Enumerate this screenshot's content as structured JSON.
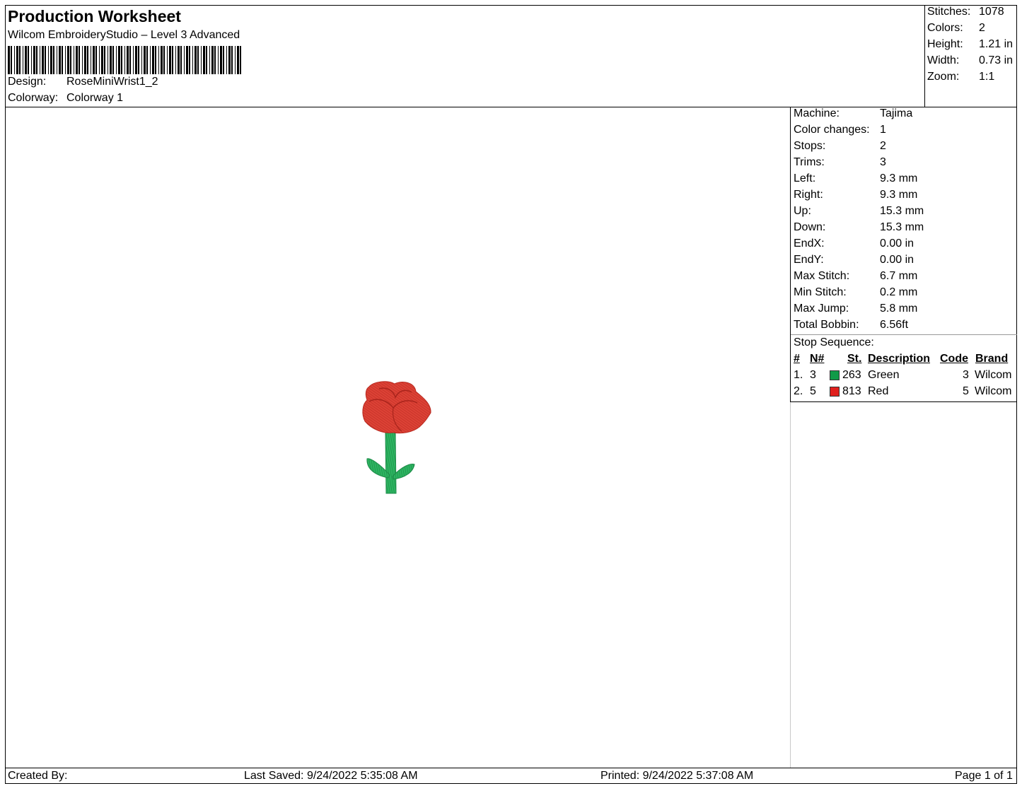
{
  "header": {
    "title": "Production Worksheet",
    "subtitle": "Wilcom EmbroideryStudio – Level 3 Advanced",
    "design_label": "Design:",
    "design_value": "RoseMiniWrist1_2",
    "colorway_label": "Colorway:",
    "colorway_value": "Colorway 1"
  },
  "summary": {
    "stitches_label": "Stitches:",
    "stitches_value": "1078",
    "colors_label": "Colors:",
    "colors_value": "2",
    "height_label": "Height:",
    "height_value": "1.21 in",
    "width_label": "Width:",
    "width_value": "0.73 in",
    "zoom_label": "Zoom:",
    "zoom_value": "1:1"
  },
  "stats": [
    {
      "label": "Machine:",
      "value": "Tajima"
    },
    {
      "label": "Color changes:",
      "value": "1"
    },
    {
      "label": "Stops:",
      "value": "2"
    },
    {
      "label": "Trims:",
      "value": "3"
    },
    {
      "label": "Left:",
      "value": "9.3 mm"
    },
    {
      "label": "Right:",
      "value": "9.3 mm"
    },
    {
      "label": "Up:",
      "value": "15.3 mm"
    },
    {
      "label": "Down:",
      "value": "15.3 mm"
    },
    {
      "label": "EndX:",
      "value": "0.00 in"
    },
    {
      "label": "EndY:",
      "value": "0.00 in"
    },
    {
      "label": "Max Stitch:",
      "value": "6.7 mm"
    },
    {
      "label": "Min Stitch:",
      "value": "0.2 mm"
    },
    {
      "label": "Max Jump:",
      "value": "5.8 mm"
    },
    {
      "label": "Total Bobbin:",
      "value": "6.56ft"
    }
  ],
  "stop_sequence": {
    "title": "Stop Sequence:",
    "headers": {
      "num": "#",
      "n": "N#",
      "st": "St.",
      "desc": "Description",
      "code": "Code",
      "brand": "Brand"
    },
    "rows": [
      {
        "num": "1.",
        "n": "3",
        "color": "#109a48",
        "st": "263",
        "desc": "Green",
        "code": "3",
        "brand": "Wilcom"
      },
      {
        "num": "2.",
        "n": "5",
        "color": "#e0201e",
        "st": "813",
        "desc": "Red",
        "code": "5",
        "brand": "Wilcom"
      }
    ]
  },
  "footer": {
    "created": "Created By:",
    "saved": "Last Saved: 9/24/2022 5:35:08 AM",
    "printed": "Printed: 9/24/2022 5:37:08 AM",
    "page": "Page 1 of 1"
  },
  "colors": {
    "rose": "#dd4236",
    "rose_dark": "#b82a20",
    "stem": "#2db562",
    "stem_dark": "#1d8a48"
  }
}
